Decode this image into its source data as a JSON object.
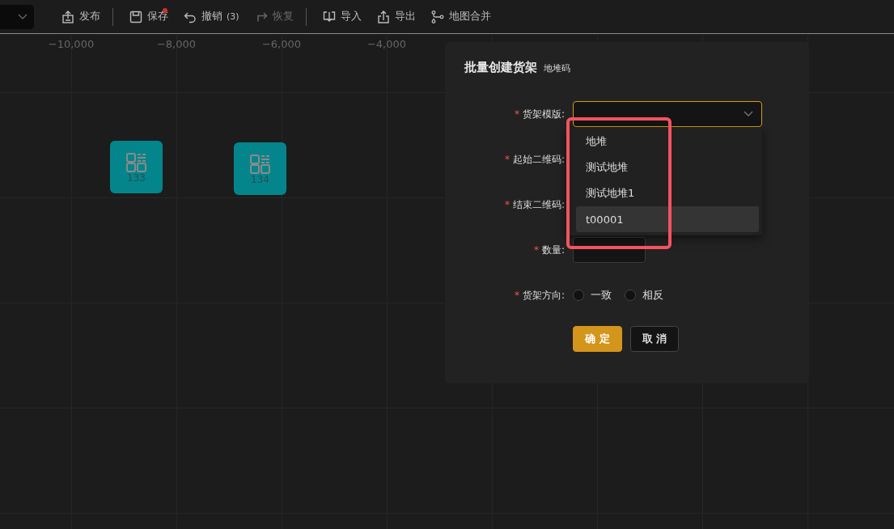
{
  "toolbar": {
    "items": [
      {
        "kind": "button",
        "label": "发布",
        "disabled": false,
        "dot": false
      },
      {
        "kind": "divider"
      },
      {
        "kind": "button",
        "label": "保存",
        "disabled": false,
        "dot": true
      },
      {
        "kind": "button",
        "label": "撤销",
        "count": "(3)",
        "disabled": false,
        "dot": false
      },
      {
        "kind": "button",
        "label": "恢复",
        "disabled": true,
        "dot": false
      },
      {
        "kind": "divider"
      },
      {
        "kind": "button",
        "label": "导入",
        "disabled": false,
        "dot": false
      },
      {
        "kind": "button",
        "label": "导出",
        "disabled": false,
        "dot": false
      },
      {
        "kind": "button",
        "label": "地图合并",
        "disabled": false,
        "dot": false
      }
    ]
  },
  "canvas": {
    "axis_labels": [
      "−10,000",
      "−8,000",
      "−6,000",
      "−4,000"
    ],
    "nodes": [
      {
        "label": "133"
      },
      {
        "label": "134"
      }
    ]
  },
  "dialog": {
    "title": "批量创建货架",
    "subtitle": "地堆码",
    "fields": [
      {
        "label": "货架模版:",
        "required_mark": "*",
        "kind": "select"
      },
      {
        "label": "起始二维码:",
        "required_mark": "*",
        "kind": "covered"
      },
      {
        "label": "结束二维码:",
        "required_mark": "*",
        "kind": "covered"
      },
      {
        "label": "数量:",
        "required_mark": "*",
        "kind": "input"
      },
      {
        "label": "货架方向:",
        "required_mark": "*",
        "kind": "radio",
        "options": [
          {
            "label": "一致",
            "selected": false
          },
          {
            "label": "相反",
            "selected": false
          }
        ]
      }
    ],
    "buttons": [
      {
        "label": "确 定",
        "kind": "primary"
      },
      {
        "label": "取 消",
        "kind": "default"
      }
    ],
    "dropdown": {
      "options": [
        {
          "label": "地堆",
          "selected": false
        },
        {
          "label": "测试地堆",
          "selected": false
        },
        {
          "label": "测试地堆1",
          "selected": false
        },
        {
          "label": "t00001",
          "selected": true
        }
      ]
    }
  }
}
